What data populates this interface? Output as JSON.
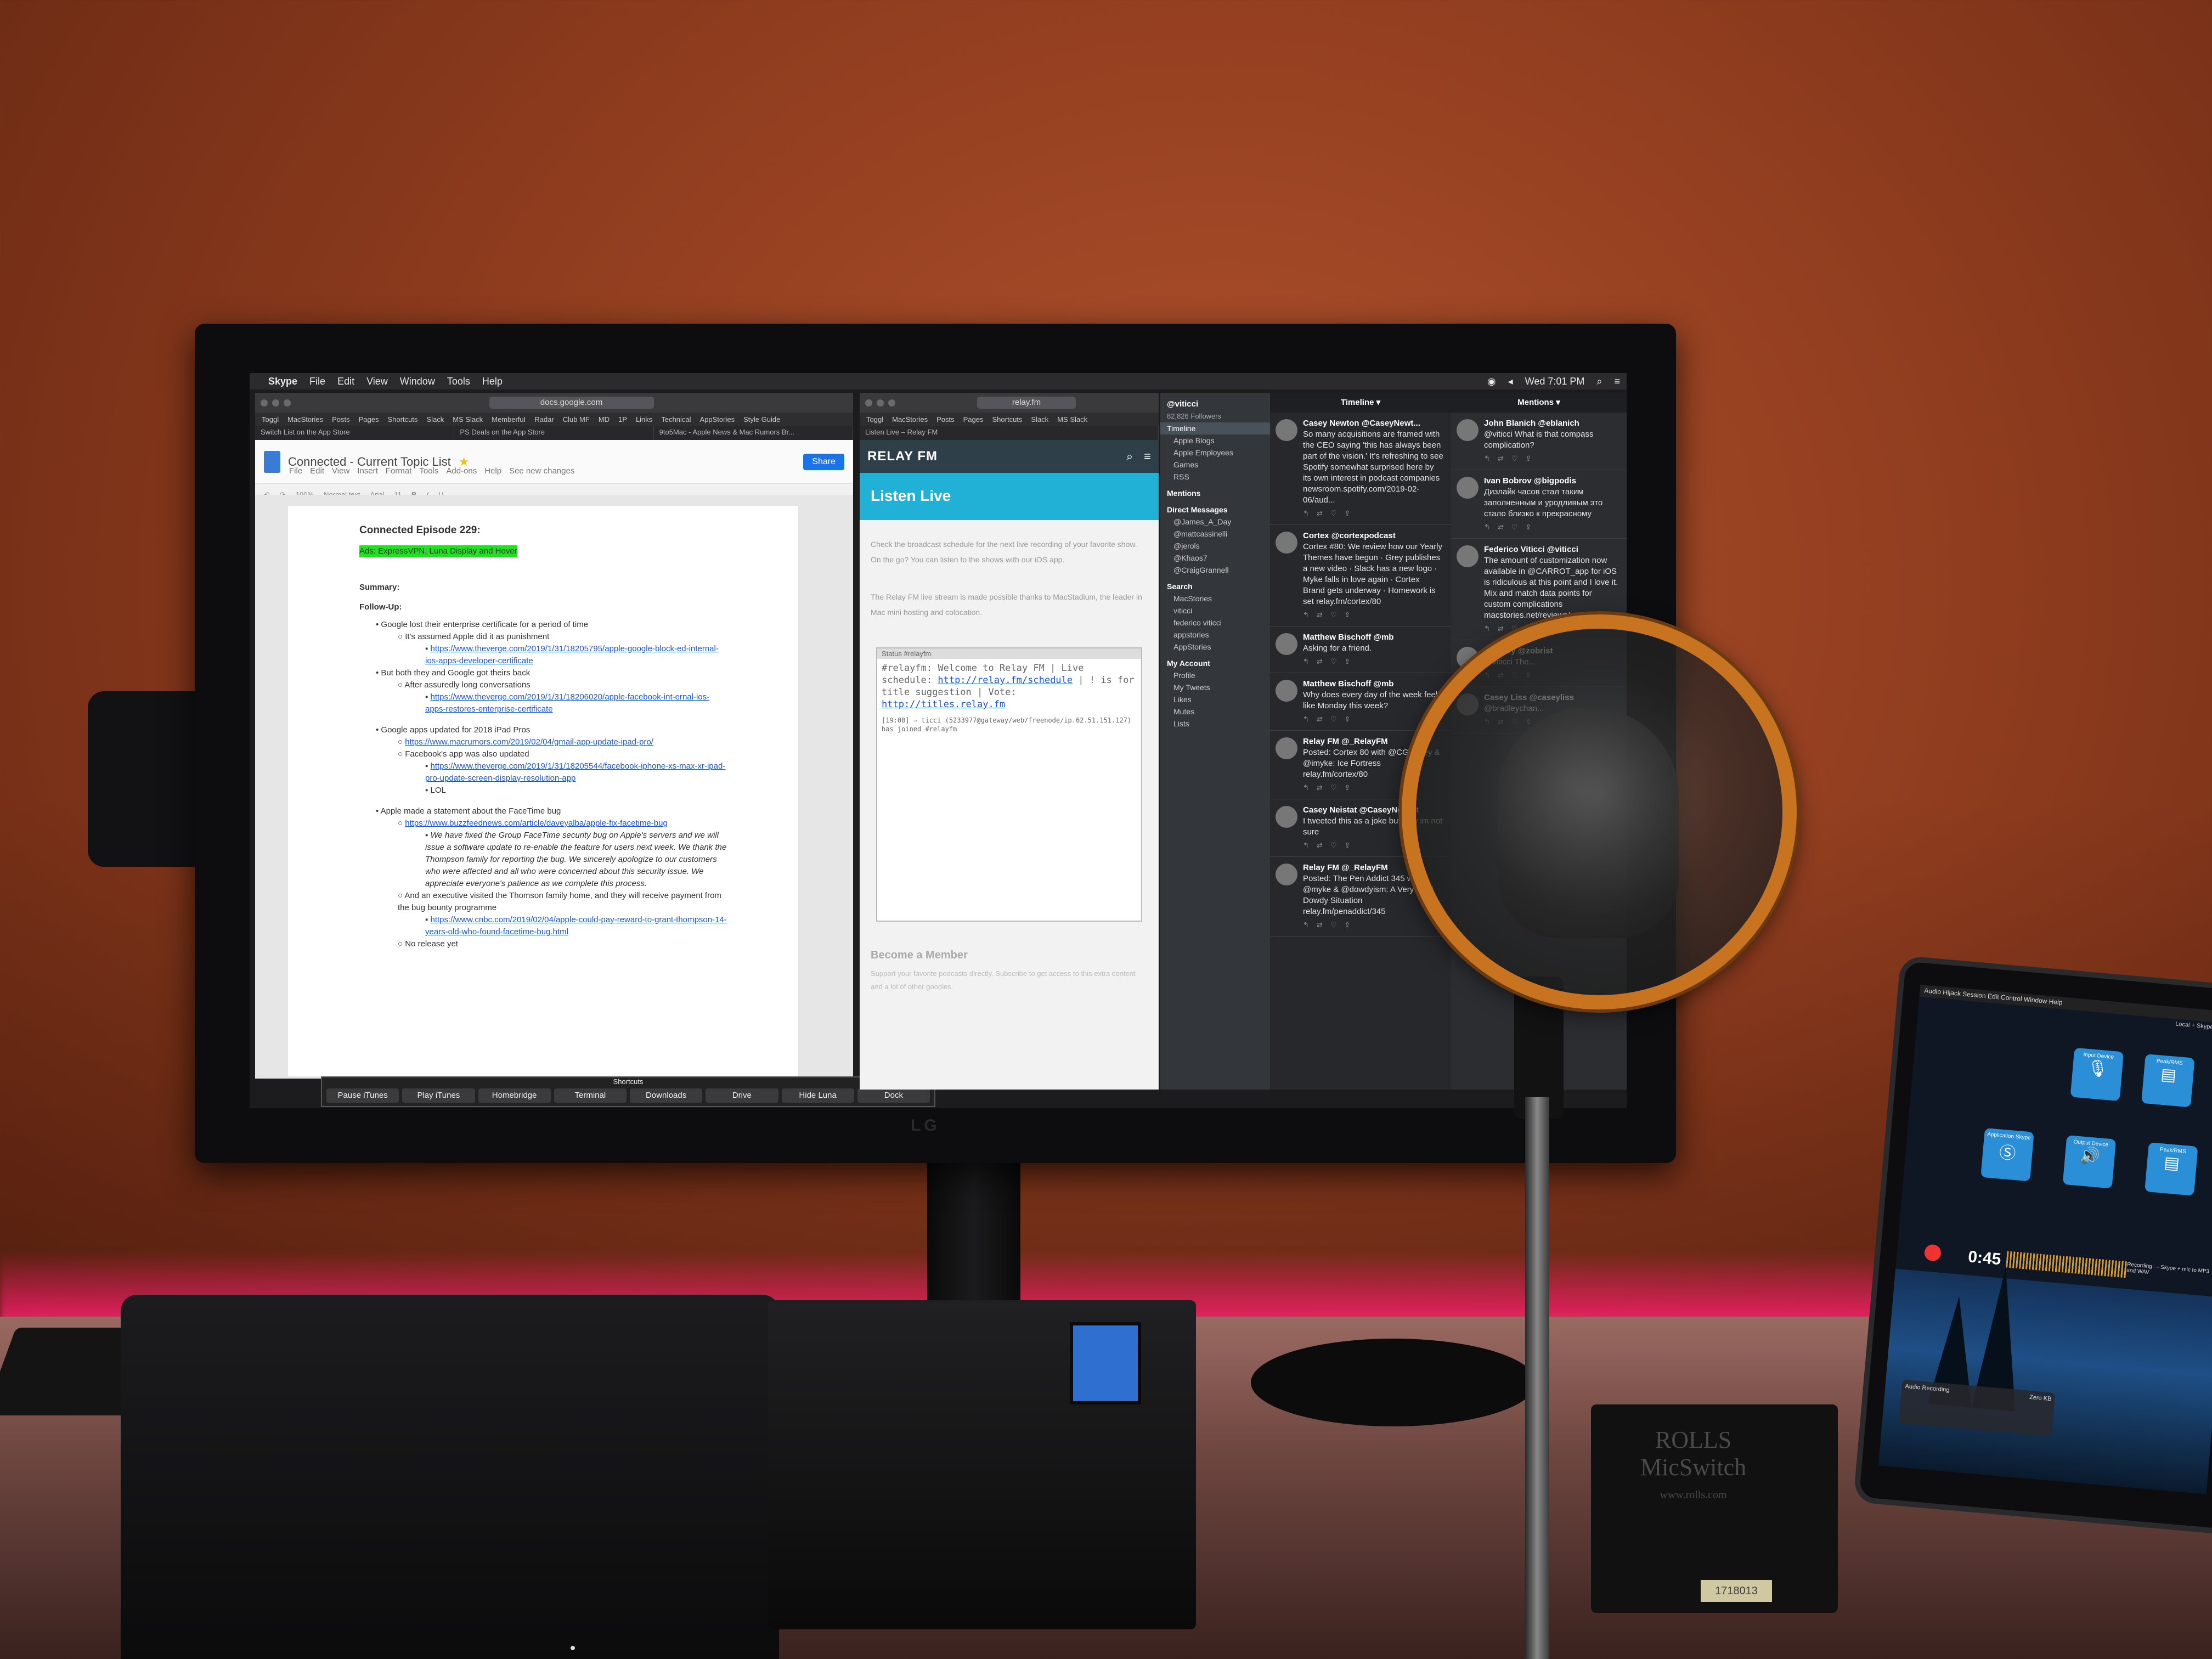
{
  "menubar": {
    "app": "Skype",
    "items": [
      "File",
      "Edit",
      "View",
      "Window",
      "Tools",
      "Help"
    ],
    "clock": "Wed 7:01 PM"
  },
  "docs": {
    "url": "docs.google.com",
    "bookmarks": [
      "Toggl",
      "MacStories",
      "Posts",
      "Pages",
      "Shortcuts",
      "Slack",
      "MS Slack",
      "MemberfuI",
      "Radar",
      "Club MF",
      "MD",
      "1P",
      "Links",
      "Technical",
      "AppStories",
      "Style Guide"
    ],
    "tabs": [
      "Switch List on the App Store",
      "PS Deals on the App Store",
      "9to5Mac - Apple News & Mac Rumors Br..."
    ],
    "title": "Connected - Current Topic List",
    "menu": [
      "File",
      "Edit",
      "View",
      "Insert",
      "Format",
      "Tools",
      "Add-ons",
      "Help",
      "See new changes"
    ],
    "share": "Share",
    "toolbar": [
      "100%",
      "Normal text",
      "Arial",
      "11"
    ],
    "heading": "Connected Episode 229:",
    "ads": "Ads: ExpressVPN, Luna Display and Hover",
    "summary": "Summary:",
    "followup": "Follow-Up:",
    "lines": [
      {
        "lvl": "l1",
        "text": "Google lost their enterprise certificate for a period of time"
      },
      {
        "lvl": "l2",
        "text": "It's assumed Apple did it as punishment"
      },
      {
        "lvl": "l3",
        "text": "https://www.theverge.com/2019/1/31/18205795/apple-google-block-ed-internal-ios-apps-developer-certificate",
        "link": true
      },
      {
        "lvl": "l1",
        "text": "But both they and Google got theirs back"
      },
      {
        "lvl": "l2",
        "text": "After assuredly long conversations"
      },
      {
        "lvl": "l3",
        "text": "https://www.theverge.com/2019/1/31/18206020/apple-facebook-int-ernal-ios-apps-restores-enterprise-certificate",
        "link": true
      },
      {
        "lvl": "gap",
        "text": ""
      },
      {
        "lvl": "l1",
        "text": "Google apps updated for 2018 iPad Pros"
      },
      {
        "lvl": "l2",
        "text": "https://www.macrumors.com/2019/02/04/gmail-app-update-ipad-pro/",
        "link": true
      },
      {
        "lvl": "l2",
        "text": "Facebook's app was also updated"
      },
      {
        "lvl": "l3",
        "text": "https://www.theverge.com/2019/1/31/18205544/facebook-iphone-xs-max-xr-ipad-pro-update-screen-display-resolution-app",
        "link": true
      },
      {
        "lvl": "l3",
        "text": "LOL"
      },
      {
        "lvl": "gap",
        "text": ""
      },
      {
        "lvl": "l1",
        "text": "Apple made a statement about the FaceTime bug"
      },
      {
        "lvl": "l2",
        "text": "https://www.buzzfeednews.com/article/daveyalba/apple-fix-facetime-bug",
        "link": true
      },
      {
        "lvl": "l3",
        "text": "We have fixed the Group FaceTime security bug on Apple's servers and we will issue a software update to re-enable the feature for users next week. We thank the Thompson family for reporting the bug. We sincerely apologize to our customers who were affected and all who were concerned about this security issue. We appreciate everyone's patience as we complete this process.",
        "ital": true
      },
      {
        "lvl": "l2",
        "text": "And an executive visited the Thomson family home, and they will receive payment from the bug bounty programme"
      },
      {
        "lvl": "l3",
        "text": "https://www.cnbc.com/2019/02/04/apple-could-pay-reward-to-grant-thompson-14-years-old-who-found-facetime-bug.html",
        "link": true
      },
      {
        "lvl": "l2",
        "text": "No release yet"
      }
    ]
  },
  "shortcuts": {
    "title": "Shortcuts",
    "buttons": [
      "Pause iTunes",
      "Play iTunes",
      "Homebridge",
      "Terminal",
      "Downloads",
      "Drive",
      "Hide Luna",
      "Dock"
    ]
  },
  "relay": {
    "url": "relay.fm",
    "bookmarks": [
      "Toggl",
      "MacStories",
      "Posts",
      "Pages",
      "Shortcuts",
      "Slack",
      "MS Slack"
    ],
    "tab": "Listen Live – Relay FM",
    "logo": "RELAY FM",
    "hero": "Listen Live",
    "body1": "Check the broadcast schedule for the next live recording of your favorite show. On the go? You can listen to the shows with our iOS app.",
    "body2": "The Relay FM live stream is made possible thanks to MacStadium, the leader in Mac mini hosting and colocation.",
    "irc_tabs": "Status   #relayfm",
    "irc_topic": "#relayfm: Welcome to Relay FM | Live schedule:",
    "irc_link1": "http://relay.fm/schedule",
    "irc_topic2": "| ! is for title suggestion | Vote:",
    "irc_link2": "http://titles.relay.fm",
    "irc_join": "[19:00] ⇒ ticci (5233977@gateway/web/freenode/ip.62.51.151.127) has joined #relayfm",
    "member": "Become a Member",
    "member_sub": "Support your favorite podcasts directly. Subscribe to get access to this extra content and a lot of other goodies."
  },
  "tweetbot": {
    "account": "@viticci",
    "followers": "82,826 Followers",
    "sidebar": [
      {
        "type": "active",
        "text": "Timeline"
      },
      {
        "type": "item",
        "text": "Apple Blogs"
      },
      {
        "type": "item",
        "text": "Apple Employees"
      },
      {
        "type": "item",
        "text": "Games"
      },
      {
        "type": "item",
        "text": "RSS"
      },
      {
        "type": "cat",
        "text": "Mentions"
      },
      {
        "type": "cat",
        "text": "Direct Messages"
      },
      {
        "type": "item",
        "text": "@James_A_Day"
      },
      {
        "type": "item",
        "text": "@mattcassinelli"
      },
      {
        "type": "item",
        "text": "@jerols"
      },
      {
        "type": "item",
        "text": "@Khaos7"
      },
      {
        "type": "item",
        "text": "@CraigGrannell"
      },
      {
        "type": "cat",
        "text": "Search"
      },
      {
        "type": "item",
        "text": "MacStories"
      },
      {
        "type": "item",
        "text": "viticci"
      },
      {
        "type": "item",
        "text": "federico viticci"
      },
      {
        "type": "item",
        "text": "appstories"
      },
      {
        "type": "item",
        "text": "AppStories"
      },
      {
        "type": "cat",
        "text": "My Account"
      },
      {
        "type": "item",
        "text": "Profile"
      },
      {
        "type": "item",
        "text": "My Tweets"
      },
      {
        "type": "item",
        "text": "Likes"
      },
      {
        "type": "item",
        "text": "Mutes"
      },
      {
        "type": "item",
        "text": "Lists"
      }
    ],
    "timeline_title": "Timeline ▾",
    "mentions_title": "Mentions ▾",
    "timeline": [
      {
        "name": "Casey Newton @CaseyNewt...",
        "text": "So many acquisitions are framed with the CEO saying 'this has always been part of the vision.' It's refreshing to see Spotify somewhat surprised here by its own interest in podcast companies newsroom.spotify.com/2019-02-06/aud..."
      },
      {
        "name": "Cortex @cortexpodcast",
        "text": "Cortex #80: We review how our Yearly Themes have begun · Grey publishes a new video · Slack has a new logo · Myke falls in love again · Cortex Brand gets underway · Homework is set relay.fm/cortex/80"
      },
      {
        "name": "Matthew Bischoff @mb",
        "text": "Asking for a friend."
      },
      {
        "name": "Matthew Bischoff @mb",
        "text": "Why does every day of the week feel like Monday this week?"
      },
      {
        "name": "Relay FM @_RelayFM",
        "text": "Posted: Cortex 80 with @CGPGrey & @imyke: Ice Fortress relay.fm/cortex/80"
      },
      {
        "name": "Casey Neistat @CaseyNeistat",
        "text": "I tweeted this as a joke but now im not sure"
      },
      {
        "name": "Relay FM @_RelayFM",
        "text": "Posted: The Pen Addict 345 with @myke & @dowdyism: A Very Brad Dowdy Situation relay.fm/penaddict/345"
      }
    ],
    "mentions": [
      {
        "name": "John Blanich @eblanich",
        "text": "@viticci What is that compass complication?"
      },
      {
        "name": "Ivan Bobrov @bigpodis",
        "text": "Дизлайк часов стал таким заполненным и уродливым это стало близко к прекрасному"
      },
      {
        "name": "Federico Viticci @viticci",
        "text": "The amount of customization now available in @CARROT_app for iOS is ridiculous at this point and I love it. Mix and match data points for custom complications macstories.net/reviews/carrot..."
      },
      {
        "name": "Zachary @zobrist",
        "text": "@viticci The..."
      },
      {
        "name": "Casey Liss @caseyliss",
        "text": "@bradleychan..."
      }
    ]
  },
  "ipad": {
    "menu": "Audio Hijack   Session   Edit   Control   Window   Help",
    "session": "Local + Skype Recording",
    "nodes": [
      "Input Device",
      "Peak/RMS",
      "Application Skype",
      "Output Device",
      "Peak/RMS"
    ],
    "time": "0:45",
    "recording": "Recording — Skype + mic to MP3 and WAV",
    "recorder_label": "Audio Recording",
    "zero_kb": "Zero KB"
  },
  "hardware": {
    "monitor_brand": "LG",
    "micswitch_brand": "ROLLS",
    "micswitch_model": "MicSwitch",
    "micswitch_url": "www.rolls.com",
    "sticker": "1718013"
  }
}
